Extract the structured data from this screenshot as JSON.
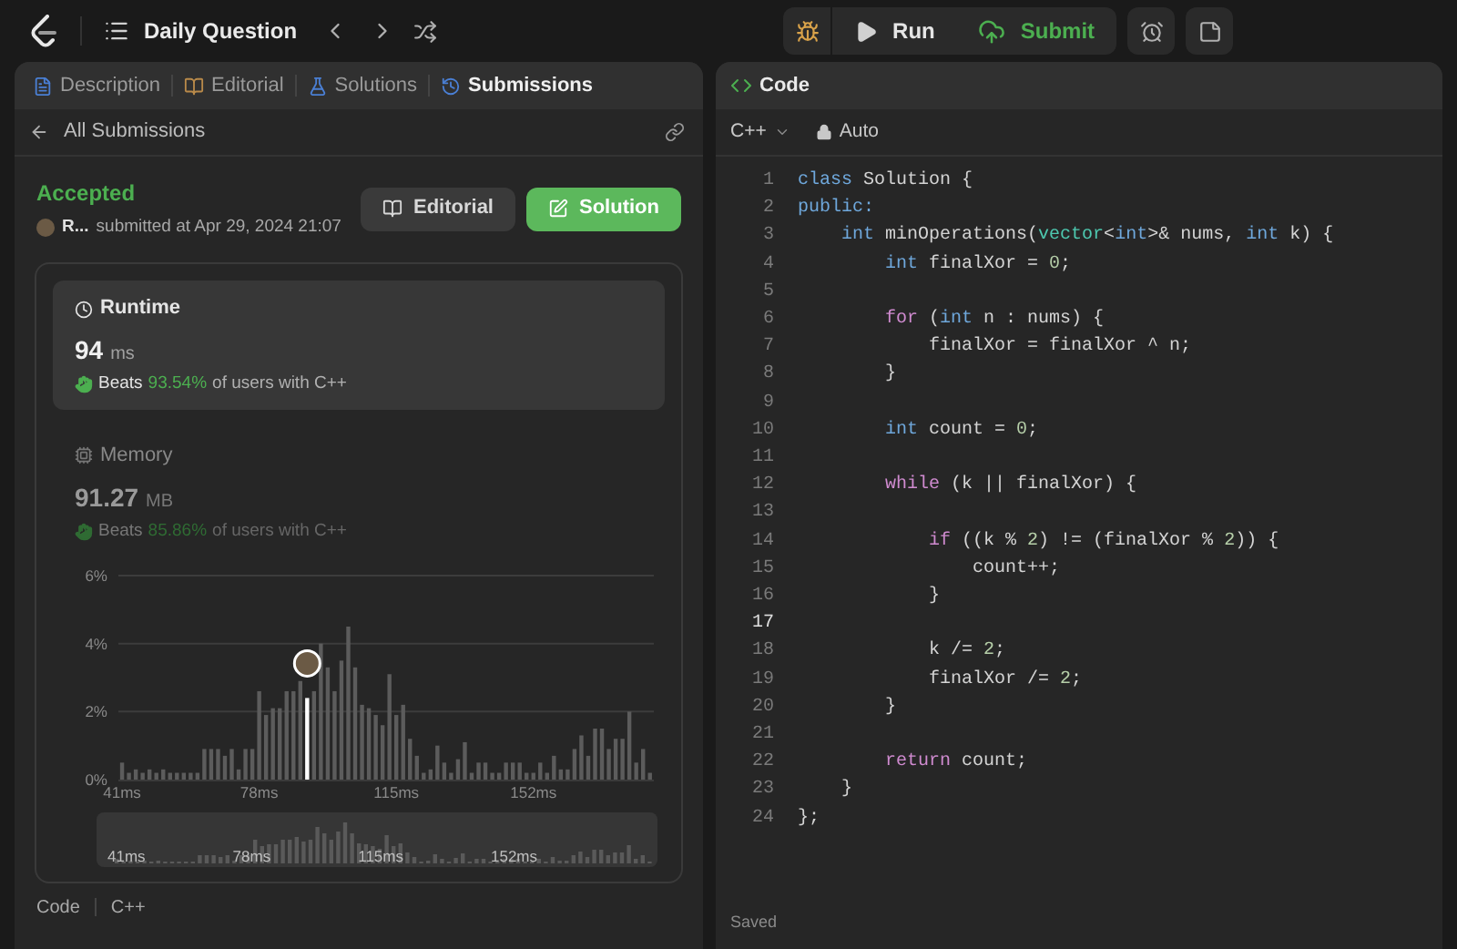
{
  "topbar": {
    "title": "Daily Question"
  },
  "actions": [
    {
      "kind": "debug"
    },
    {
      "kind": "run",
      "label": "Run"
    },
    {
      "kind": "submit",
      "label": "Submit"
    },
    {
      "kind": "timer"
    },
    {
      "kind": "note"
    }
  ],
  "left_tabs": [
    {
      "kind": "description",
      "label": "Description",
      "selected": false
    },
    {
      "kind": "editorial",
      "label": "Editorial",
      "selected": false
    },
    {
      "kind": "solutions",
      "label": "Solutions",
      "selected": false
    },
    {
      "kind": "submissions",
      "label": "Submissions",
      "selected": true
    }
  ],
  "back_link": "All Submissions",
  "submission": {
    "status": "Accepted",
    "user": "R...",
    "submitted": "submitted at Apr 29, 2024 21:07",
    "buttons": [
      {
        "kind": "editorial",
        "label": "Editorial"
      },
      {
        "kind": "solution",
        "label": "Solution"
      }
    ]
  },
  "metrics": [
    {
      "kind": "runtime",
      "title": "Runtime",
      "value": "94",
      "unit": "ms",
      "beats_label": "Beats",
      "beats": "93.54%",
      "suffix": "of users with C++",
      "selected": true
    },
    {
      "kind": "memory",
      "title": "Memory",
      "value": "91.27",
      "unit": "MB",
      "beats_label": "Beats",
      "beats": "85.86%",
      "suffix": "of users with C++",
      "selected": false
    }
  ],
  "chart_data": {
    "type": "bar",
    "xlim": [
      40,
      184.5
    ],
    "ylim": [
      0,
      6
    ],
    "yticks": [
      {
        "value": 0,
        "label": "0%"
      },
      {
        "value": 2,
        "label": "2%"
      },
      {
        "value": 4,
        "label": "4%"
      },
      {
        "value": 6,
        "label": "6%"
      }
    ],
    "xticks": [
      {
        "value": 41,
        "label": "41ms"
      },
      {
        "value": 78,
        "label": "78ms"
      },
      {
        "value": 115,
        "label": "115ms"
      },
      {
        "value": 152,
        "label": "152ms"
      }
    ],
    "x": [
      41,
      42.85,
      44.7,
      46.55,
      48.4,
      50.25,
      52.1,
      53.95,
      55.8,
      57.65,
      59.5,
      61.35,
      63.2,
      65.05,
      66.9,
      68.75,
      70.6,
      72.45,
      74.3,
      76.15,
      78,
      79.85,
      81.7,
      83.55,
      85.4,
      87.25,
      89.1,
      90.95,
      92.8,
      94.65,
      96.5,
      98.35,
      100.2,
      102.05,
      103.9,
      105.75,
      107.6,
      109.45,
      111.3,
      113.15,
      115,
      116.85,
      118.7,
      120.55,
      122.4,
      124.25,
      126.1,
      127.95,
      129.8,
      131.65,
      133.5,
      135.35,
      137.2,
      139.05,
      140.9,
      142.75,
      144.6,
      146.45,
      148.3,
      150.15,
      152,
      153.85,
      155.7,
      157.55,
      159.4,
      161.25,
      163.1,
      164.95,
      166.8,
      168.65,
      170.5,
      172.35,
      174.2,
      176.05,
      177.9,
      179.75,
      181.6,
      183.45
    ],
    "series": [
      {
        "color": "#5c5c5c",
        "values": [
          0.5,
          0.2,
          0.3,
          0.2,
          0.3,
          0.2,
          0.3,
          0.2,
          0.2,
          0.2,
          0.2,
          0.2,
          0.9,
          0.9,
          0.9,
          0.7,
          0.9,
          0.3,
          0.9,
          0.9,
          2.6,
          1.9,
          2.1,
          2.1,
          2.6,
          2.6,
          2.9,
          null,
          2.6,
          4.0,
          3.3,
          2.6,
          3.5,
          4.5,
          3.3,
          2.2,
          2.1,
          1.9,
          1.6,
          3.1,
          1.9,
          2.2,
          1.2,
          0.7,
          0.2,
          0.3,
          1.0,
          0.5,
          0.2,
          0.6,
          1.1,
          0.2,
          0.5,
          0.5,
          0.2,
          0.2,
          0.5,
          0.5,
          0.5,
          0.2,
          0.2,
          0.5,
          0.2,
          0.7,
          0.3,
          0.3,
          0.9,
          1.3,
          0.7,
          1.5,
          1.5,
          0.9,
          1.2,
          1.2,
          2.0,
          0.5,
          0.9,
          0.2
        ]
      },
      {
        "color": "#ffffff",
        "values": [
          null,
          null,
          null,
          null,
          null,
          null,
          null,
          null,
          null,
          null,
          null,
          null,
          null,
          null,
          null,
          null,
          null,
          null,
          null,
          null,
          null,
          null,
          null,
          null,
          null,
          null,
          null,
          2.4,
          null,
          null,
          null,
          null,
          null,
          null,
          null,
          null,
          null,
          null,
          null,
          null,
          null,
          null,
          null,
          null,
          null,
          null,
          null,
          null,
          null,
          null,
          null,
          null,
          null,
          null,
          null,
          null,
          null,
          null,
          null,
          null,
          null,
          null,
          null,
          null,
          null,
          null,
          null,
          null,
          null,
          null,
          null,
          null,
          null,
          null,
          null,
          null,
          null,
          null
        ]
      }
    ]
  },
  "overview_labels": [
    "41ms",
    "78ms",
    "115ms",
    "152ms"
  ],
  "bottom_tabs": [
    "Code",
    "C++"
  ],
  "code_panel": {
    "title": "Code",
    "language": "C++",
    "mode": "Auto",
    "status": "Saved",
    "lines": [
      {
        "number": "1",
        "selected": false,
        "tokens": [
          {
            "kind": "kw",
            "text": "class"
          },
          {
            "kind": "plain",
            "text": " Solution {"
          }
        ]
      },
      {
        "number": "2",
        "selected": false,
        "tokens": [
          {
            "kind": "kw",
            "text": "public:"
          }
        ]
      },
      {
        "number": "3",
        "selected": false,
        "tokens": [
          {
            "kind": "kw",
            "text": "    int"
          },
          {
            "kind": "plain",
            "text": " minOperations("
          },
          {
            "kind": "type",
            "text": "vector"
          },
          {
            "kind": "plain",
            "text": "<"
          },
          {
            "kind": "kw",
            "text": "int"
          },
          {
            "kind": "plain",
            "text": ">& nums, "
          },
          {
            "kind": "kw",
            "text": "int"
          },
          {
            "kind": "plain",
            "text": " k) {"
          }
        ]
      },
      {
        "number": "4",
        "selected": false,
        "tokens": [
          {
            "kind": "kw",
            "text": "        int"
          },
          {
            "kind": "plain",
            "text": " finalXor = "
          },
          {
            "kind": "num",
            "text": "0"
          },
          {
            "kind": "plain",
            "text": ";"
          }
        ]
      },
      {
        "number": "5",
        "selected": false
      },
      {
        "number": "6",
        "selected": false,
        "tokens": [
          {
            "kind": "ctrl",
            "text": "        for"
          },
          {
            "kind": "plain",
            "text": " ("
          },
          {
            "kind": "kw",
            "text": "int"
          },
          {
            "kind": "plain",
            "text": " n : nums) {"
          }
        ]
      },
      {
        "number": "7",
        "selected": false,
        "tokens": [
          {
            "kind": "plain",
            "text": "            finalXor = finalXor ^ n;"
          }
        ]
      },
      {
        "number": "8",
        "selected": false,
        "tokens": [
          {
            "kind": "plain",
            "text": "        }"
          }
        ]
      },
      {
        "number": "9",
        "selected": false
      },
      {
        "number": "10",
        "selected": false,
        "tokens": [
          {
            "kind": "kw",
            "text": "        int"
          },
          {
            "kind": "plain",
            "text": " count = "
          },
          {
            "kind": "num",
            "text": "0"
          },
          {
            "kind": "plain",
            "text": ";"
          }
        ]
      },
      {
        "number": "11",
        "selected": false
      },
      {
        "number": "12",
        "selected": false,
        "tokens": [
          {
            "kind": "ctrl",
            "text": "        while"
          },
          {
            "kind": "plain",
            "text": " (k || finalXor) {"
          }
        ]
      },
      {
        "number": "13",
        "selected": false
      },
      {
        "number": "14",
        "selected": false,
        "tokens": [
          {
            "kind": "ctrl",
            "text": "            if"
          },
          {
            "kind": "plain",
            "text": " ((k % "
          },
          {
            "kind": "num",
            "text": "2"
          },
          {
            "kind": "plain",
            "text": ") != (finalXor % "
          },
          {
            "kind": "num",
            "text": "2"
          },
          {
            "kind": "plain",
            "text": ")) {"
          }
        ]
      },
      {
        "number": "15",
        "selected": false,
        "tokens": [
          {
            "kind": "plain",
            "text": "                count++;"
          }
        ]
      },
      {
        "number": "16",
        "selected": false,
        "tokens": [
          {
            "kind": "plain",
            "text": "            }"
          }
        ]
      },
      {
        "number": "17",
        "selected": true
      },
      {
        "number": "18",
        "selected": false,
        "tokens": [
          {
            "kind": "plain",
            "text": "            k /= "
          },
          {
            "kind": "num",
            "text": "2"
          },
          {
            "kind": "plain",
            "text": ";"
          }
        ]
      },
      {
        "number": "19",
        "selected": false,
        "tokens": [
          {
            "kind": "plain",
            "text": "            finalXor /= "
          },
          {
            "kind": "num",
            "text": "2"
          },
          {
            "kind": "plain",
            "text": ";"
          }
        ]
      },
      {
        "number": "20",
        "selected": false,
        "tokens": [
          {
            "kind": "plain",
            "text": "        }"
          }
        ]
      },
      {
        "number": "21",
        "selected": false
      },
      {
        "number": "22",
        "selected": false,
        "tokens": [
          {
            "kind": "ctrl",
            "text": "        return"
          },
          {
            "kind": "plain",
            "text": " count;"
          }
        ]
      },
      {
        "number": "23",
        "selected": false,
        "tokens": [
          {
            "kind": "plain",
            "text": "    }"
          }
        ]
      },
      {
        "number": "24",
        "selected": false,
        "tokens": [
          {
            "kind": "plain",
            "text": "};"
          }
        ]
      }
    ]
  }
}
